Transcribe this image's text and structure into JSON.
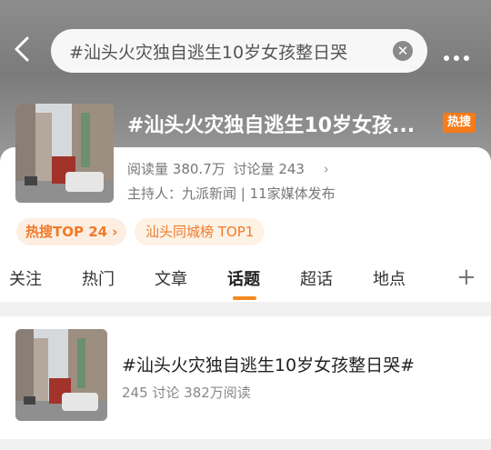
{
  "search": {
    "query": "#汕头火灾独自逃生10岁女孩整日哭"
  },
  "topic": {
    "title": "#汕头火灾独自逃生10岁女孩...",
    "badge": "热搜",
    "reads_label": "阅读量",
    "reads": "380.7万",
    "discuss_label": "讨论量",
    "discuss": "243",
    "chevron": "›",
    "host_text": "主持人：九派新闻 | 11家媒体发布"
  },
  "chips": {
    "hot": "热搜TOP 24 ›",
    "city": "汕头同城榜 TOP1"
  },
  "tabs": [
    "关注",
    "热门",
    "文章",
    "话题",
    "超话",
    "地点"
  ],
  "active_tab": "话题",
  "result": {
    "title": "#汕头火灾独自逃生10岁女孩整日哭#",
    "meta": "245 讨论 382万阅读"
  },
  "colors": {
    "accent": "#f28a22",
    "badge": "#f57b1b",
    "chip_text": "#f07a2a"
  },
  "icons": [
    "back-arrow-icon",
    "clear-icon",
    "more-icon",
    "plus-icon",
    "chevron-right-icon"
  ]
}
